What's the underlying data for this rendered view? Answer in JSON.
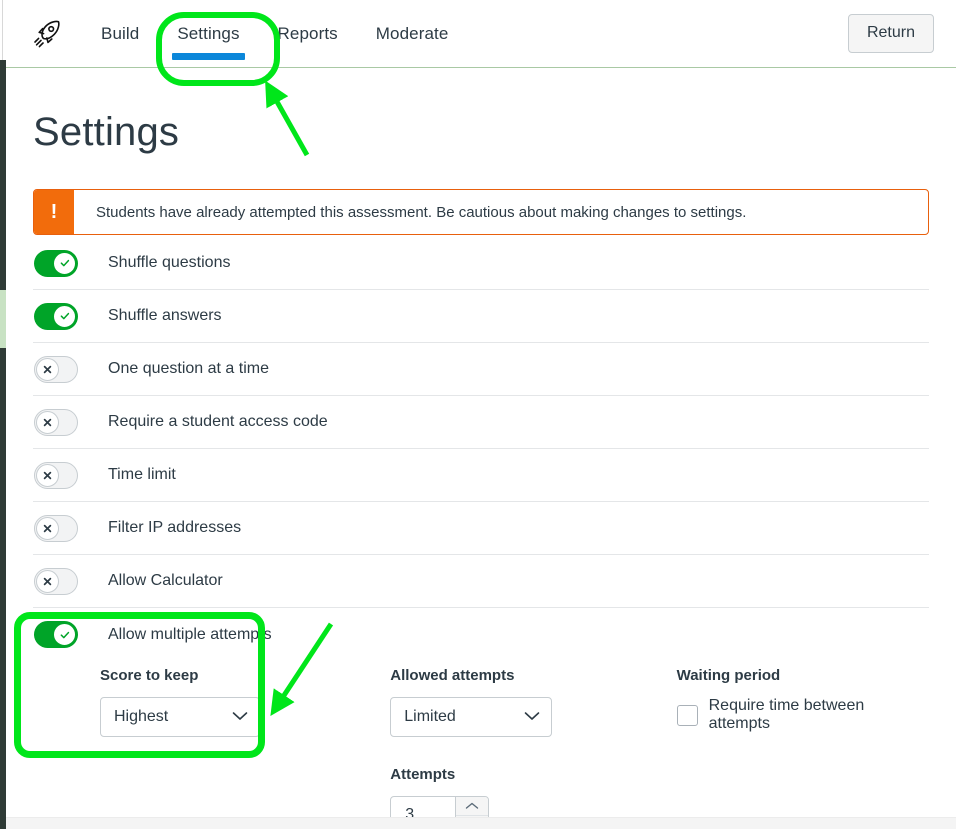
{
  "window": {
    "product_icon": "rocket-icon"
  },
  "topnav": {
    "items": [
      {
        "label": "Build",
        "active": false
      },
      {
        "label": "Settings",
        "active": true
      },
      {
        "label": "Reports",
        "active": false
      },
      {
        "label": "Moderate",
        "active": false
      }
    ],
    "return_label": "Return",
    "active_underline_color": "#0b87da"
  },
  "page": {
    "title": "Settings"
  },
  "warning": {
    "icon": "!",
    "icon_bg": "#f26c0c",
    "border_color": "#e8600d",
    "message": "Students have already attempted this assessment. Be cautious about making changes to settings."
  },
  "settings": {
    "rows": [
      {
        "label": "Shuffle questions",
        "state": "on"
      },
      {
        "label": "Shuffle answers",
        "state": "on"
      },
      {
        "label": "One question at a time",
        "state": "off"
      },
      {
        "label": "Require a student access code",
        "state": "off"
      },
      {
        "label": "Time limit",
        "state": "off"
      },
      {
        "label": "Filter IP addresses",
        "state": "off"
      },
      {
        "label": "Allow Calculator",
        "state": "off"
      },
      {
        "label": "Allow multiple attempts",
        "state": "on"
      }
    ],
    "on_color": "#00a428",
    "off_track_color": "#f2f3f4"
  },
  "multiple_attempts": {
    "score_to_keep": {
      "label": "Score to keep",
      "value": "Highest"
    },
    "allowed_attempts": {
      "label": "Allowed attempts",
      "value": "Limited"
    },
    "attempts": {
      "label": "Attempts",
      "value": "3"
    },
    "waiting_period": {
      "label": "Waiting period",
      "checkbox_label": "Require time between attempts",
      "checked": false
    }
  },
  "annotations": {
    "color": "#00e61a",
    "highlight_tab": "Settings",
    "highlight_panel": "Score to keep"
  }
}
